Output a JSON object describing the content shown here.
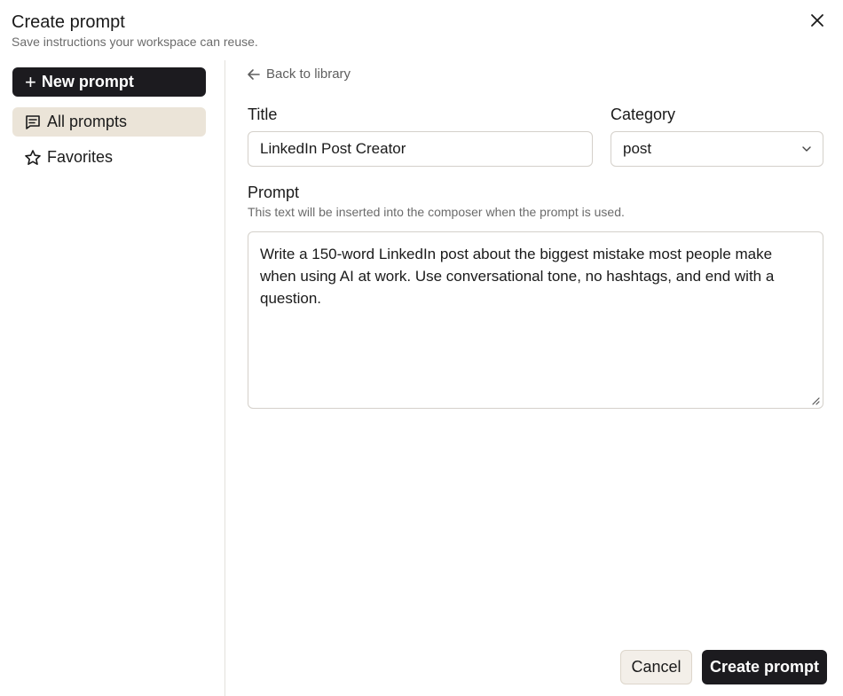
{
  "dialog": {
    "title": "Create prompt",
    "subtitle": "Save instructions your workspace can reuse."
  },
  "sidebar": {
    "new_button": "New prompt",
    "items": [
      {
        "label": "All prompts",
        "icon": "message-square-icon",
        "active": true
      },
      {
        "label": "Favorites",
        "icon": "star-icon",
        "active": false
      }
    ]
  },
  "main": {
    "back_link": "Back to library",
    "title_label": "Title",
    "title_value": "LinkedIn Post Creator",
    "category_label": "Category",
    "category_value": "post",
    "prompt_label": "Prompt",
    "prompt_hint": "This text will be inserted into the composer when the prompt is used.",
    "prompt_value": "Write a 150-word LinkedIn post about the biggest mistake most people make when using AI at work. Use conversational tone, no hashtags, and end with a question."
  },
  "footer": {
    "cancel_label": "Cancel",
    "create_label": "Create prompt"
  },
  "colors": {
    "primary": "#1c1b1f",
    "active_item": "#ebe4d8",
    "cancel_bg": "#f3efe9"
  }
}
